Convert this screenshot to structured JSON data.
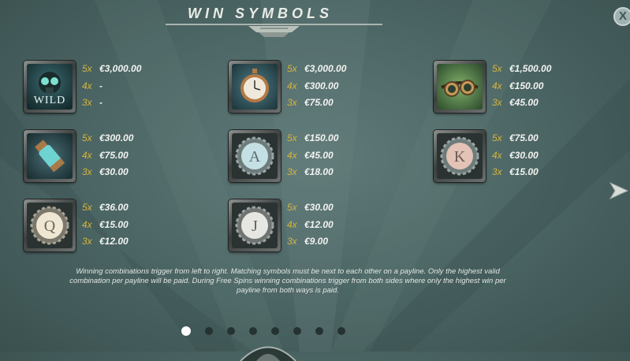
{
  "header": {
    "title": "WIN SYMBOLS",
    "close_label": "X"
  },
  "symbols": [
    {
      "name": "wild",
      "label": "WILD",
      "pays": [
        {
          "count": "5x",
          "value": "€3,000.00"
        },
        {
          "count": "4x",
          "value": "-"
        },
        {
          "count": "3x",
          "value": "-"
        }
      ]
    },
    {
      "name": "pocket-watch",
      "pays": [
        {
          "count": "5x",
          "value": "€3,000.00"
        },
        {
          "count": "4x",
          "value": "€300.00"
        },
        {
          "count": "3x",
          "value": "€75.00"
        }
      ]
    },
    {
      "name": "goggles",
      "pays": [
        {
          "count": "5x",
          "value": "€1,500.00"
        },
        {
          "count": "4x",
          "value": "€150.00"
        },
        {
          "count": "3x",
          "value": "€45.00"
        }
      ]
    },
    {
      "name": "potion-vial",
      "pays": [
        {
          "count": "5x",
          "value": "€300.00"
        },
        {
          "count": "4x",
          "value": "€75.00"
        },
        {
          "count": "3x",
          "value": "€30.00"
        }
      ]
    },
    {
      "name": "letter-a",
      "letter": "A",
      "pays": [
        {
          "count": "5x",
          "value": "€150.00"
        },
        {
          "count": "4x",
          "value": "€45.00"
        },
        {
          "count": "3x",
          "value": "€18.00"
        }
      ]
    },
    {
      "name": "letter-k",
      "letter": "K",
      "pays": [
        {
          "count": "5x",
          "value": "€75.00"
        },
        {
          "count": "4x",
          "value": "€30.00"
        },
        {
          "count": "3x",
          "value": "€15.00"
        }
      ]
    },
    {
      "name": "letter-q",
      "letter": "Q",
      "pays": [
        {
          "count": "5x",
          "value": "€36.00"
        },
        {
          "count": "4x",
          "value": "€15.00"
        },
        {
          "count": "3x",
          "value": "€12.00"
        }
      ]
    },
    {
      "name": "letter-j",
      "letter": "J",
      "pays": [
        {
          "count": "5x",
          "value": "€30.00"
        },
        {
          "count": "4x",
          "value": "€12.00"
        },
        {
          "count": "3x",
          "value": "€9.00"
        }
      ]
    }
  ],
  "rules": {
    "line1": "Winning combinations trigger from left to right. Matching symbols must be next to each other on a payline. Only the highest valid",
    "line2": "combination per payline will be paid. During Free Spins winning combinations trigger from both sides where only the highest win per",
    "line3": "payline from both ways is paid."
  },
  "pagination": {
    "total": 8,
    "current": 1
  },
  "colors": {
    "multiplier": "#d8b43c",
    "value": "#f2f3f0",
    "background": "#4a6463"
  }
}
